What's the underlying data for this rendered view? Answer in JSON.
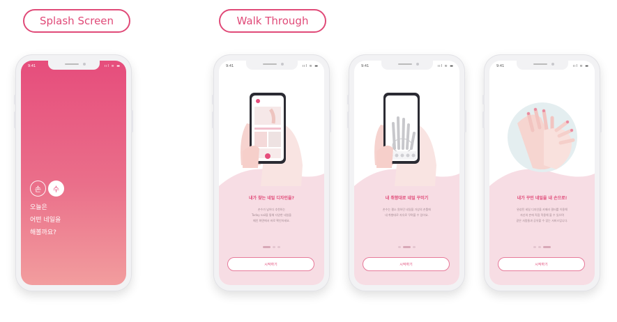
{
  "sections": {
    "splash": "Splash Screen",
    "walk": "Walk Through"
  },
  "status": {
    "time": "9:41",
    "icons": "ııl ≋ ▬"
  },
  "splash": {
    "logo": [
      "손",
      "수"
    ],
    "lines": [
      "오늘은",
      "어떤 네일을",
      "해볼까요?"
    ]
  },
  "walk": [
    {
      "title": "내가 찾는 네일 디자인을?",
      "body": [
        "손수가 넘어다 추천하는",
        "Today nail을 통해 다양한 네일을",
        "메인 화면에서 바로 확인하세요."
      ],
      "active_dot": 1
    },
    {
      "title": "내 취향대로 네일 꾸미기",
      "body": [
        "손수는 평소 원하던 네일을 가상의 손톱에",
        "내 취향대로 자유로 꾸며볼 수 있어요."
      ],
      "active_dot": 2
    },
    {
      "title": "내가 꾸민 네일을 내 손으로!",
      "body": [
        "완성된 세일 디자인을 카메라 필터를 이용해",
        "자신의 손에 직접 적용해 볼 수 있으며",
        "같은 사람들과 공유할 수 있는 서비스입니다."
      ],
      "active_dot": 3
    }
  ],
  "start_label": "시작하기",
  "colors": {
    "accent": "#e04a78",
    "splash_top": "#e64d7c",
    "splash_bottom": "#f29d9e",
    "wave": "#f7dde4"
  }
}
